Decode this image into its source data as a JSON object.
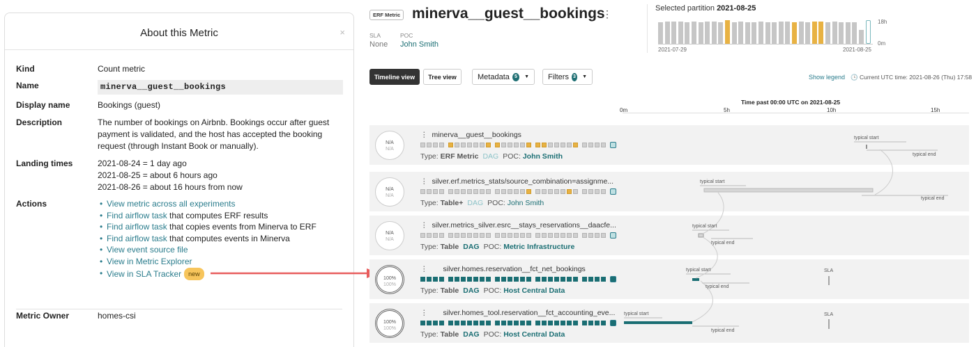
{
  "about": {
    "title": "About this Metric",
    "close": "×",
    "kind_label": "Kind",
    "kind": "Count metric",
    "name_label": "Name",
    "name": "minerva__guest__bookings",
    "display_label": "Display name",
    "display": "Bookings (guest)",
    "desc_label": "Description",
    "desc": "The number of bookings on Airbnb. Bookings occur after guest payment is validated, and the host has accepted the booking request (through Instant Book or manually).",
    "landing_label": "Landing times",
    "landing": [
      "2021-08-24 = 1 day ago",
      "2021-08-25 = about 6 hours ago",
      "2021-08-26 = about 16 hours from now"
    ],
    "actions_label": "Actions",
    "actions": [
      {
        "link": "View metric across all experiments",
        "rest": ""
      },
      {
        "link": "Find airflow task",
        "rest": " that computes ERF results"
      },
      {
        "link": "Find airflow task",
        "rest": " that copies events from Minerva to ERF"
      },
      {
        "link": "Find airflow task",
        "rest": " that computes events in Minerva"
      },
      {
        "link": "View event source file",
        "rest": ""
      },
      {
        "link": "View in Metric Explorer",
        "rest": ""
      },
      {
        "link": "View in SLA Tracker",
        "rest": ""
      }
    ],
    "new_badge": "new",
    "owner_label": "Metric Owner",
    "owner": "homes-csi"
  },
  "header": {
    "badge": "ERF Metric",
    "title": "minerva__guest__bookings",
    "kebab": "⋮",
    "sla_label": "SLA",
    "sla": "None",
    "poc_label": "POC",
    "poc": "John Smith",
    "partition_label": "Selected partition",
    "partition": "2021-08-25",
    "y_top": "18h",
    "y_bottom": "0m",
    "x_start": "2021-07-29",
    "x_end": "2021-08-25",
    "histogram": [
      0.9,
      0.95,
      0.95,
      0.95,
      0.9,
      0.95,
      0.9,
      0.95,
      0.95,
      0.9,
      1.0,
      0.9,
      0.95,
      0.9,
      0.9,
      0.95,
      0.9,
      0.9,
      0.95,
      0.95,
      0.9,
      0.95,
      0.9,
      0.95,
      0.95,
      0.9,
      0.95,
      0.9,
      0.9,
      0.9,
      0.6,
      1.0
    ],
    "histogram_orange": [
      10,
      20,
      23,
      24
    ]
  },
  "toolbar": {
    "timeline": "Timeline view",
    "tree": "Tree view",
    "metadata": "Metadata",
    "metadata_count": "5",
    "filters": "Filters",
    "filters_count": "3",
    "show_legend": "Show legend",
    "utc": "Current UTC time: 2021-08-26 (Thu) 17:58"
  },
  "timeline": {
    "title": "Time past 00:00 UTC on 2021-08-25",
    "ticks": [
      "0m",
      "5h",
      "10h",
      "15h"
    ],
    "typical_start": "typical start",
    "typical_end": "typical end",
    "sla": "SLA"
  },
  "rows": [
    {
      "status": "N/A",
      "status_sub": "N/A",
      "ok": false,
      "name": "minerva__guest__bookings",
      "type_label": "Type:",
      "type": "ERF Metric",
      "dag": "DAG",
      "dag_active": false,
      "poc_label": "POC:",
      "poc": "John Smith",
      "poc_bold": true,
      "blocks": "g g g g o g g g g g o o g g g g o o o g g g g o g g g g",
      "teal": false
    },
    {
      "status": "N/A",
      "status_sub": "N/A",
      "ok": false,
      "name": "silver.erf.metrics_stats/source_combination=assignme...",
      "type_label": "Type:",
      "type": "Table+",
      "dag": "DAG",
      "dag_active": false,
      "poc_label": "POC:",
      "poc": "John Smith",
      "poc_bold": false,
      "blocks": "g g g g g g g g g g g g g g g g o g g g g g o g g g g g",
      "teal": false
    },
    {
      "status": "N/A",
      "status_sub": "N/A",
      "ok": false,
      "name": "silver.metrics_silver.esrc__stays_reservations__daacfe...",
      "type_label": "Type:",
      "type": "Table",
      "dag": "DAG",
      "dag_active": true,
      "poc_label": "POC:",
      "poc": "Metric Infrastructure",
      "poc_bold": true,
      "blocks": "g g g g g g g g g g g g g g g g g g g g g g g g g g g g",
      "teal": false
    },
    {
      "status": "100%",
      "status_sub": "100%",
      "ok": true,
      "name": "silver.homes.reservation__fct_net_bookings",
      "type_label": "Type:",
      "type": "Table",
      "dag": "DAG",
      "dag_active": true,
      "poc_label": "POC:",
      "poc": "Host Central Data",
      "poc_bold": true,
      "blocks": "t t t t t t t t t t t t t t t t t t t t t t t t t t t t",
      "teal": true
    },
    {
      "status": "100%",
      "status_sub": "100%",
      "ok": true,
      "name": "silver.homes_tool.reservation__fct_accounting_eve...",
      "type_label": "Type:",
      "type": "Table",
      "dag": "DAG",
      "dag_active": true,
      "poc_label": "POC:",
      "poc": "Host Central Data",
      "poc_bold": true,
      "blocks": "t t t t t t t t t t t t t t t t t t t t t t t t t t t t",
      "teal": true
    }
  ]
}
